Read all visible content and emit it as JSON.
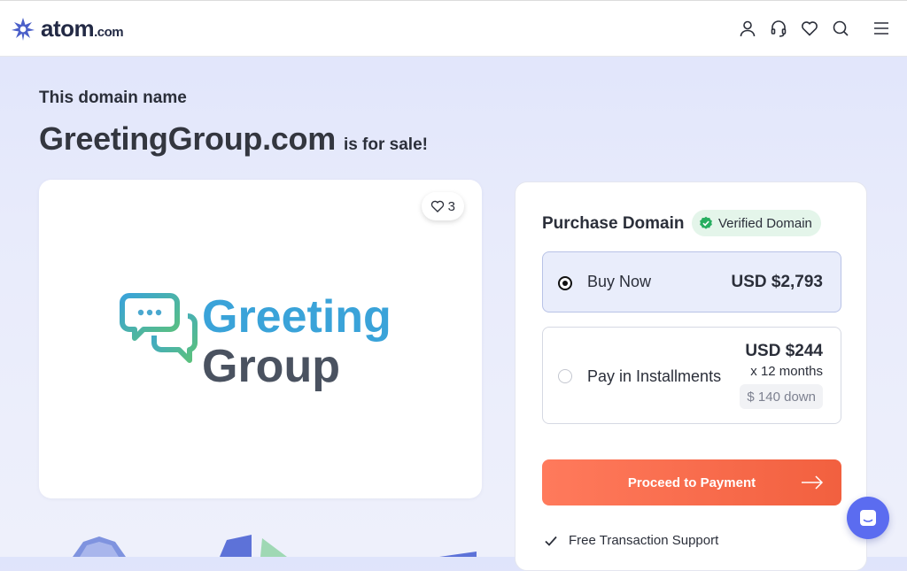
{
  "header": {
    "logo_text": "atom",
    "logo_suffix": ".com",
    "icons": [
      "user-icon",
      "headset-icon",
      "heart-icon",
      "search-icon",
      "menu-icon"
    ]
  },
  "hero": {
    "eyebrow": "This domain name",
    "domain": "GreetingGroup.com",
    "suffix": "is for sale!"
  },
  "logo_card": {
    "likes": "3",
    "brand_line1": "Greeting",
    "brand_line2": "Group"
  },
  "purchase": {
    "title": "Purchase Domain",
    "verified_label": "Verified Domain",
    "buy_now": {
      "label": "Buy Now",
      "price": "USD $2,793",
      "selected": true
    },
    "installments": {
      "label": "Pay in Installments",
      "price": "USD $244",
      "months": "x 12 months",
      "down": "$ 140 down",
      "selected": false
    },
    "proceed_label": "Proceed to Payment",
    "feature": "Free Transaction Support"
  },
  "colors": {
    "accent": "#f2603f",
    "brand_blue": "#3aa3d9",
    "brand_dark": "#4a5260",
    "verified_green": "#27ae60",
    "chat_blue": "#5b6cf0"
  }
}
